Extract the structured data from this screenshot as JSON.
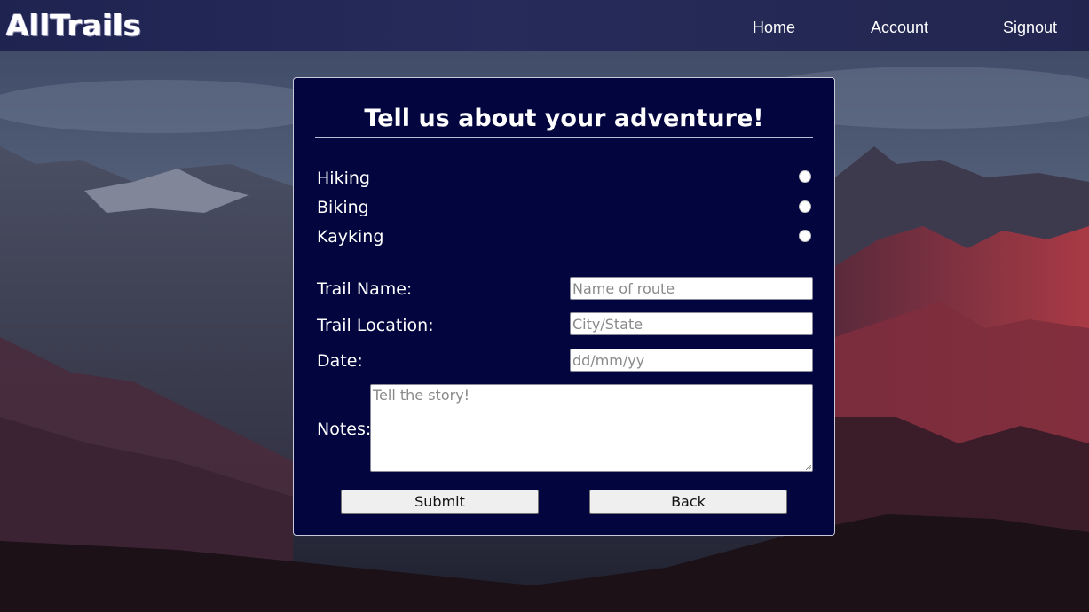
{
  "app": {
    "logo_text": "AllTrails"
  },
  "nav": {
    "items": [
      {
        "label": "Home"
      },
      {
        "label": "Account"
      },
      {
        "label": "Signout"
      }
    ]
  },
  "form": {
    "title": "Tell us about your adventure!",
    "activities": [
      {
        "label": "Hiking",
        "selected": false
      },
      {
        "label": "Biking",
        "selected": false
      },
      {
        "label": "Kayking",
        "selected": false
      }
    ],
    "fields": {
      "trail_name": {
        "label": "Trail Name:",
        "value": "",
        "placeholder": "Name of route"
      },
      "trail_location": {
        "label": "Trail Location:",
        "value": "",
        "placeholder": "City/State"
      },
      "date": {
        "label": "Date:",
        "value": "",
        "placeholder": "dd/mm/yy"
      },
      "notes": {
        "label": "Notes:",
        "value": "",
        "placeholder": "Tell the story!"
      }
    },
    "buttons": {
      "submit_label": "Submit",
      "back_label": "Back"
    }
  },
  "colors": {
    "navbar": "#22264f",
    "card_background": "#02053e",
    "text": "#ffffff",
    "button_background": "#efefef"
  }
}
